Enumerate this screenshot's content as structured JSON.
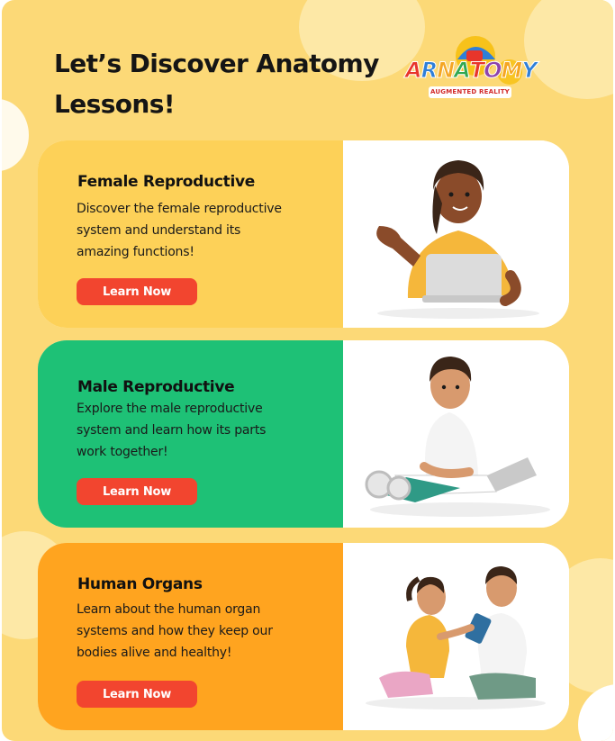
{
  "page": {
    "title_line1": "Let’s Discover Anatomy",
    "title_line2": "Lessons!"
  },
  "logo": {
    "letters": [
      "A",
      "R",
      "N",
      "A",
      "T",
      "O",
      "M",
      "Y"
    ],
    "letter_colors": [
      "#e8352b",
      "#2f7fd8",
      "#f5a623",
      "#33a852",
      "#e8352b",
      "#8e44ad",
      "#f5a623",
      "#2f7fd8"
    ],
    "subtitle": "AUGMENTED REALITY"
  },
  "colors": {
    "background": "#fcd977",
    "card_female": "#fdd158",
    "card_male": "#1ec176",
    "card_organs": "#ffa41f",
    "button": "#f2452f"
  },
  "cards": [
    {
      "title": "Female Reproductive",
      "description": [
        "Discover the female reproductive",
        "system and understand its",
        "amazing functions!"
      ],
      "button_label": "Learn Now",
      "illustration": "woman-with-laptop"
    },
    {
      "title": "Male Reproductive",
      "description": [
        "Explore the male reproductive",
        "system and learn how its parts",
        "work together!"
      ],
      "button_label": "Learn Now",
      "illustration": "man-studying-with-laptop"
    },
    {
      "title": "Human Organs",
      "description": [
        "Learn about the human organ",
        "systems and how they keep our",
        "bodies alive and healthy!"
      ],
      "button_label": "Learn Now",
      "illustration": "two-students-with-tablet"
    }
  ]
}
